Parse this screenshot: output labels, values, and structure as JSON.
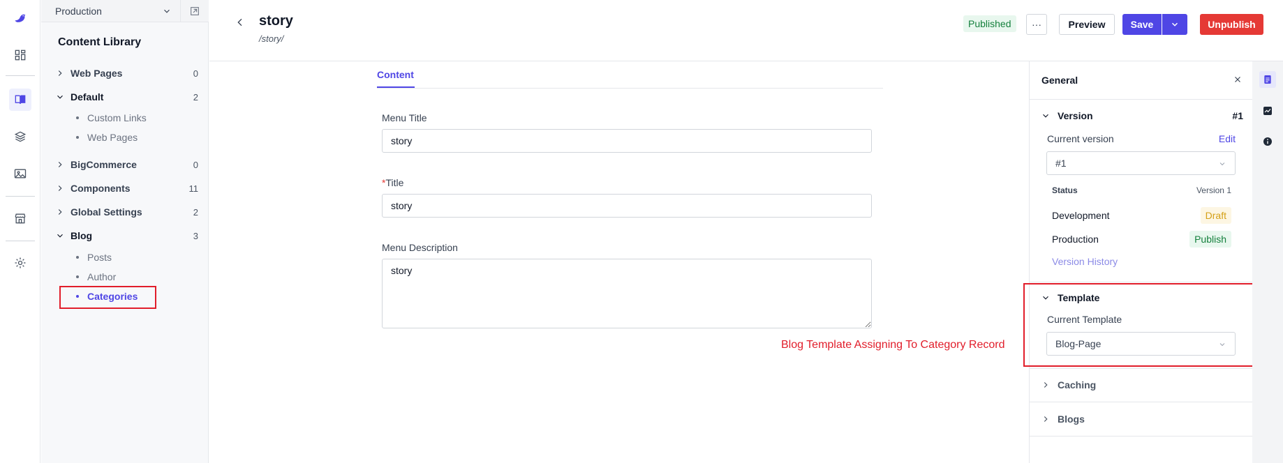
{
  "environment": {
    "name": "Production"
  },
  "library": {
    "title": "Content Library",
    "tree": [
      {
        "label": "Web Pages",
        "count": "0",
        "expanded": false
      },
      {
        "label": "Default",
        "count": "2",
        "expanded": true,
        "children": [
          "Custom Links",
          "Web Pages"
        ]
      },
      {
        "label": "BigCommerce",
        "count": "0",
        "expanded": false
      },
      {
        "label": "Components",
        "count": "11",
        "expanded": false
      },
      {
        "label": "Global Settings",
        "count": "2",
        "expanded": false
      },
      {
        "label": "Blog",
        "count": "3",
        "expanded": true,
        "children": [
          "Posts",
          "Author",
          "Categories"
        ]
      }
    ]
  },
  "header": {
    "title": "story",
    "path": "/story/",
    "status_badge": "Published",
    "more_label": "···",
    "preview_label": "Preview",
    "save_label": "Save",
    "unpublish_label": "Unpublish"
  },
  "form": {
    "tab": "Content",
    "fields": {
      "menu_title": {
        "label": "Menu Title",
        "value": "story"
      },
      "title": {
        "label": "Title",
        "required_mark": "*",
        "value": "story"
      },
      "menu_description": {
        "label": "Menu Description",
        "value": "story"
      }
    }
  },
  "annotation": "Blog Template Assigning To Category Record",
  "panel": {
    "title": "General",
    "version": {
      "heading": "Version",
      "number": "#1",
      "current_label": "Current version",
      "edit_label": "Edit",
      "selected": "#1",
      "status_label": "Status",
      "status_version": "Version 1",
      "development_label": "Development",
      "development_state": "Draft",
      "production_label": "Production",
      "production_state": "Publish",
      "history_link": "Version History"
    },
    "template": {
      "heading": "Template",
      "current_label": "Current Template",
      "selected": "Blog-Page"
    },
    "caching_heading": "Caching",
    "blogs_heading": "Blogs"
  },
  "colors": {
    "accent": "#4f46e5",
    "danger": "#e53935",
    "success": "#15803d",
    "highlight": "#e11d2a"
  }
}
